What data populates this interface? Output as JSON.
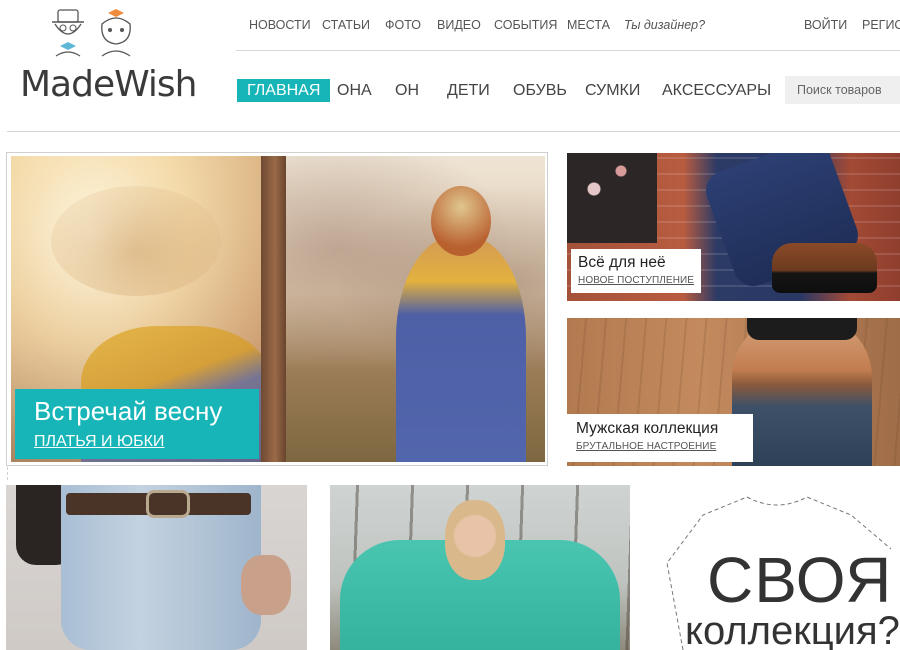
{
  "brand": {
    "name": "MadeWish"
  },
  "top_nav": {
    "items": [
      "НОВОСТИ",
      "СТАТЬИ",
      "ФОТО",
      "ВИДЕО",
      "СОБЫТИЯ",
      "МЕСТА",
      "Ты дизайнер?"
    ],
    "login": "ВОЙТИ",
    "register": "РЕГИСТ"
  },
  "main_nav": {
    "items": [
      "ГЛАВНАЯ",
      "ОНА",
      "ОН",
      "ДЕТИ",
      "ОБУВЬ",
      "СУМКИ",
      "АКСЕССУАРЫ"
    ],
    "active_index": 0
  },
  "search": {
    "placeholder": "Поиск товаров"
  },
  "hero": {
    "title": "Встречай весну",
    "subtitle": "ПЛАТЬЯ И ЮБКИ"
  },
  "cards": [
    {
      "title": "Всё для неё",
      "subtitle": "НОВОЕ ПОСТУПЛЕНИЕ"
    },
    {
      "title": "Мужская коллекция",
      "subtitle": "БРУТАЛЬНОЕ НАСТРОЕНИЕ"
    }
  ],
  "promo": {
    "title": "СВОЯ",
    "subtitle": "коллекция?"
  },
  "colors": {
    "accent": "#18b5b8",
    "text": "#333333",
    "nav_text": "#555555",
    "divider": "#d8d8d8"
  },
  "icons": [
    "hipster-couple-logo-icon"
  ]
}
